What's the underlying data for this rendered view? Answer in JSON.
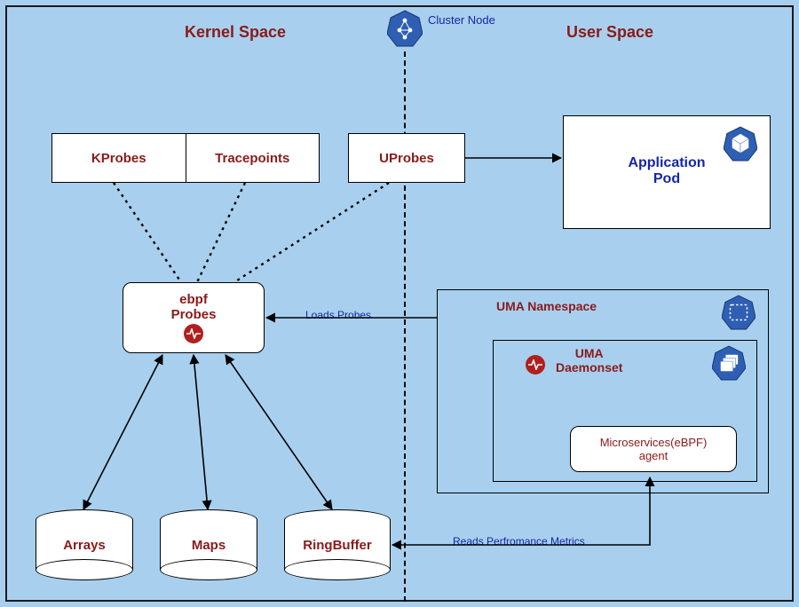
{
  "titles": {
    "kernel_space": "Kernel Space",
    "user_space": "User Space",
    "cluster_node": "Cluster Node"
  },
  "boxes": {
    "kprobes": "KProbes",
    "tracepoints": "Tracepoints",
    "uprobes": "UProbes",
    "ebpf_probes_line1": "ebpf",
    "ebpf_probes_line2": "Probes",
    "app_pod_line1": "Application",
    "app_pod_line2": "Pod",
    "uma_namespace": "UMA Namespace",
    "uma_daemonset_line1": "UMA",
    "uma_daemonset_line2": "Daemonset",
    "ms_agent_line1": "Microservices(eBPF)",
    "ms_agent_line2": "agent"
  },
  "cylinders": {
    "arrays": "Arrays",
    "maps": "Maps",
    "ringbuffer": "RingBuffer"
  },
  "edge_labels": {
    "loads_probes": "Loads Probes",
    "reads_metrics": "Reads Perfromance Metrics"
  },
  "colors": {
    "bg": "#a8d0ee",
    "text_red": "#8b1a1a",
    "text_blue": "#1625a8",
    "icon_blue": "#2e5fb3",
    "badge_red": "#b21e1e"
  }
}
